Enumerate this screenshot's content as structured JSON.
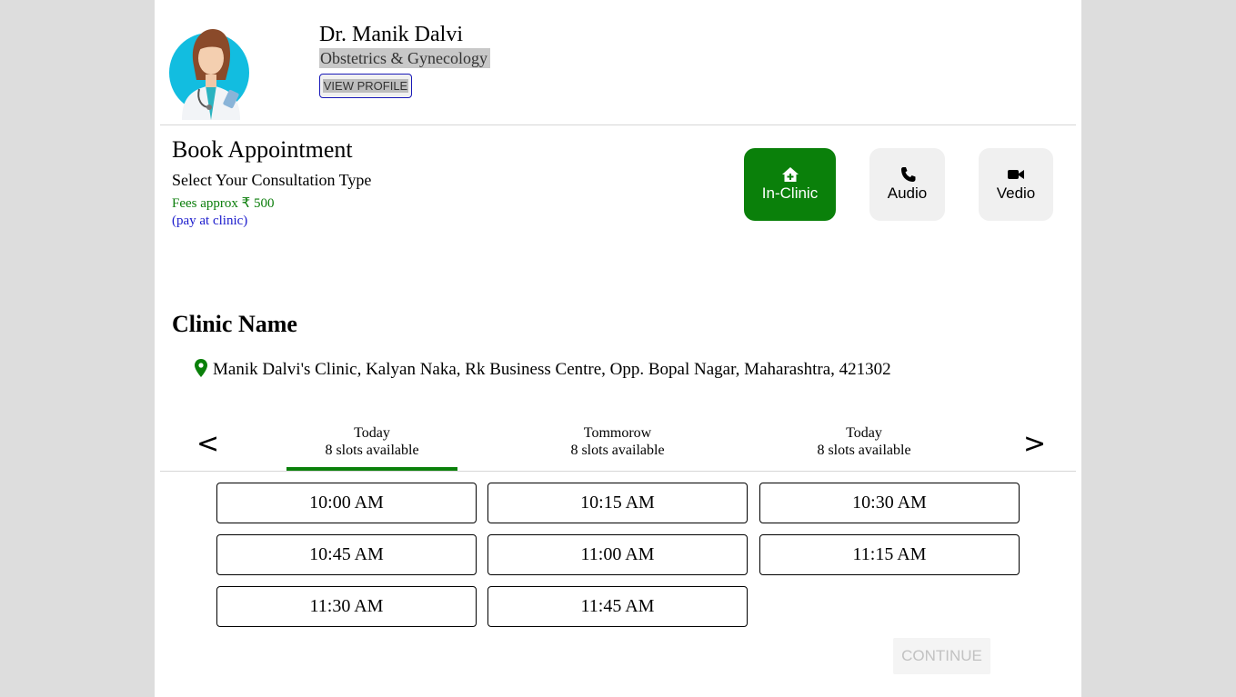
{
  "doctor": {
    "name": "Dr. Manik Dalvi",
    "specialty": "Obstetrics & Gynecology",
    "view_profile_label": "VIEW PROFILE"
  },
  "booking": {
    "title": "Book Appointment",
    "subtitle": "Select Your Consultation Type",
    "fees": "Fees approx ₹ 500",
    "pay_note": "(pay at clinic)"
  },
  "consultation_types": [
    {
      "label": "In-Clinic",
      "icon": "home-plus-icon",
      "selected": true
    },
    {
      "label": "Audio",
      "icon": "phone-icon",
      "selected": false
    },
    {
      "label": "Vedio",
      "icon": "video-camera-icon",
      "selected": false
    }
  ],
  "clinic": {
    "title": "Clinic Name",
    "address": "Manik Dalvi's Clinic, Kalyan Naka, Rk Business Centre, Opp. Bopal Nagar, Maharashtra, 421302",
    "pin_icon": "location-pin-icon"
  },
  "date_nav": {
    "prev": "<",
    "next": ">",
    "tabs": [
      {
        "day": "Today",
        "slots": "8 slots available",
        "selected": true
      },
      {
        "day": "Tommorow",
        "slots": "8 slots available",
        "selected": false
      },
      {
        "day": "Today",
        "slots": "8 slots available",
        "selected": false
      }
    ]
  },
  "slots": [
    "10:00 AM",
    "10:15 AM",
    "10:30 AM",
    "10:45 AM",
    "11:00 AM",
    "11:15 AM",
    "11:30 AM",
    "11:45 AM"
  ],
  "continue_label": "CONTINUE",
  "colors": {
    "accent_green": "#0a800a",
    "link_blue": "#1a1acc",
    "page_background": "#dddddd"
  }
}
